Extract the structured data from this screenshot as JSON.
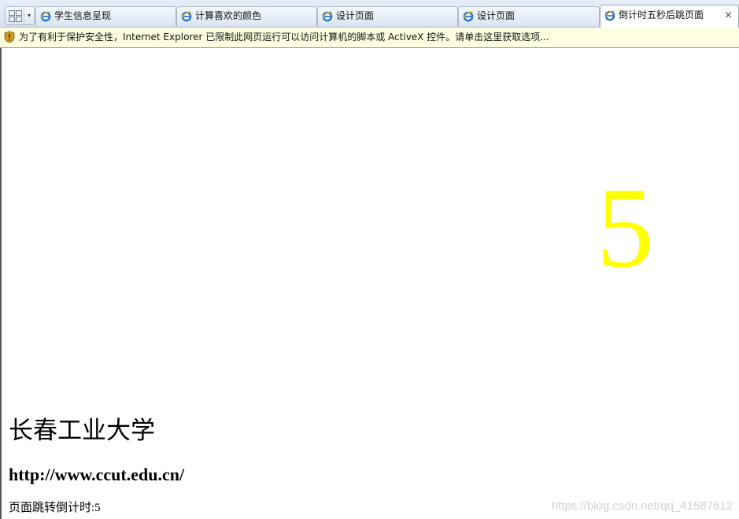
{
  "tabs": [
    {
      "label": "学生信息呈现",
      "icon": "ie-page-icon",
      "active": false
    },
    {
      "label": "计算喜欢的颜色",
      "icon": "ie-page-icon",
      "active": false
    },
    {
      "label": "设计页面",
      "icon": "ie-page-icon",
      "active": false
    },
    {
      "label": "设计页面",
      "icon": "ie-page-icon",
      "active": false
    },
    {
      "label": "倒计时五秒后跳页面",
      "icon": "ie-page-icon",
      "active": true,
      "close": "×"
    }
  ],
  "quick_tabs": {
    "dropdown": "▾"
  },
  "infobar": {
    "icon": "shield-warning-icon",
    "text": "为了有利于保护安全性，Internet Explorer 已限制此网页运行可以访问计算机的脚本或 ActiveX 控件。请单击这里获取选项..."
  },
  "page": {
    "countdown_number": "5",
    "countdown_color": "#ffff00",
    "school_name": "长春工业大学",
    "url": "http://www.ccut.edu.cn/",
    "status_text": "页面跳转倒计时:5"
  },
  "watermark": "https://blog.csdn.net/qq_41587612"
}
